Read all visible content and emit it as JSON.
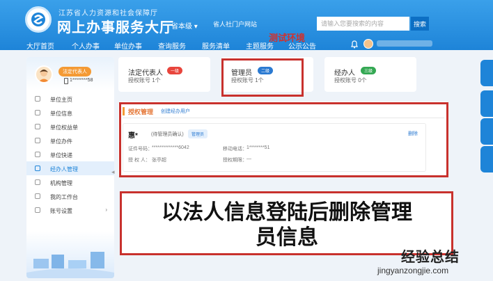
{
  "header": {
    "org_name": "江苏省人力资源和社会保障厅",
    "site_title": "网上办事服务大厅",
    "region_label": "省本级 ▾",
    "portal_link": "省人社门户网站",
    "search_placeholder": "请输入您要搜索的内容",
    "search_button": "搜索",
    "test_env": "测试环境"
  },
  "nav": {
    "items": [
      "大厅首页",
      "个人办事",
      "单位办事",
      "查询服务",
      "服务清单",
      "主题服务",
      "公示公告"
    ]
  },
  "sidebar": {
    "role_badge": "法定代表人",
    "profile_id": "1********58",
    "items": [
      {
        "label": "单位主页"
      },
      {
        "label": "单位信息"
      },
      {
        "label": "单位权益单"
      },
      {
        "label": "单位办件"
      },
      {
        "label": "单位快递"
      },
      {
        "label": "经办人管理"
      },
      {
        "label": "机构管理"
      },
      {
        "label": "我的工作台"
      },
      {
        "label": "账号设置"
      }
    ],
    "account_chevron": "›",
    "collapse_arrow": "◂"
  },
  "cards": [
    {
      "title": "法定代表人",
      "badge": "一级",
      "badge_color": "#e8453c",
      "sub": "授权账号  1个"
    },
    {
      "title": "管理员",
      "badge": "二级",
      "badge_color": "#2b7ad1",
      "sub": "授权账号  1个"
    },
    {
      "title": "经办人",
      "badge": "三级",
      "badge_color": "#34a853",
      "sub": "授权账号  0个"
    }
  ],
  "auth": {
    "title": "授权管理",
    "create_link": "创建经办用户",
    "user": {
      "name": "惠*",
      "status": "(待管理员确认)",
      "role": "管理员",
      "delete": "删除",
      "id_label": "证件号码：",
      "id_value": "**************6042",
      "phone_label": "移动电话：",
      "phone_value": "1********51",
      "grantor_label": "授 权 人：",
      "grantor_value": "张亭超",
      "period_label": "授权期限：",
      "period_value": "—"
    }
  },
  "annotation": {
    "line1": "以法人信息登陆后删除管理",
    "line2": "员信息"
  },
  "watermark": {
    "cn": "经验总结",
    "en": "jingyanzongjie.com"
  },
  "colors": {
    "primary": "#1e84d8",
    "highlight": "#c8312d",
    "accent": "#f49a34"
  }
}
